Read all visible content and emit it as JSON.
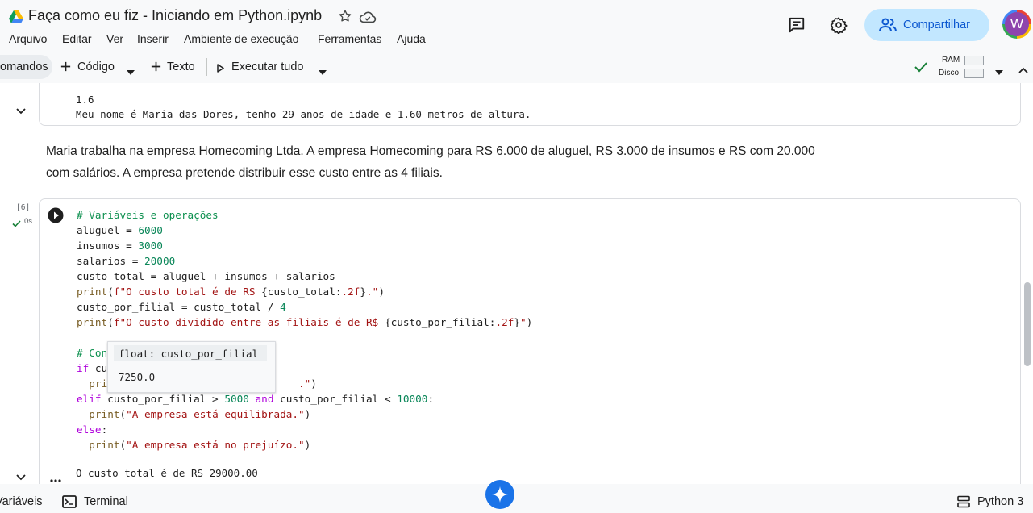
{
  "header": {
    "title": "Faça como eu fiz - Iniciando em Python.ipynb",
    "menu": [
      "Arquivo",
      "Editar",
      "Ver",
      "Inserir",
      "Ambiente de execução",
      "Ferramentas",
      "Ajuda"
    ],
    "share_label": "Compartilhar",
    "avatar_letter": "W"
  },
  "toolbar": {
    "commands_label": "omandos",
    "code_label": "Código",
    "text_label": "Texto",
    "run_all_label": "Executar tudo",
    "ram_label": "RAM",
    "disk_label": "Disco"
  },
  "output_top": {
    "line1": "1.6",
    "line2": "Meu nome é Maria das Dores, tenho 29 anos de idade e 1.60 metros de altura."
  },
  "text_cell": {
    "line1": "Maria trabalha na empresa Homecoming Ltda. A empresa Homecoming para RS 6.000 de aluguel, RS 3.000 de insumos e RS com 20.000",
    "line2": "com salários. A empresa pretende distribuir esse custo entre as 4 filiais."
  },
  "code_cell": {
    "exec_count": "[6]",
    "exec_time": "0s",
    "tooltip_signature": "float: custo_por_filial",
    "tooltip_value": "7250.0",
    "output_line": "O custo total é de RS 29000.00"
  },
  "statusbar": {
    "variables_label": "Variáveis",
    "terminal_label": "Terminal",
    "kernel_label": "Python 3"
  },
  "colors": {
    "accent": "#0b57d0",
    "share_bg": "#c2e7ff",
    "check_green": "#188038"
  }
}
